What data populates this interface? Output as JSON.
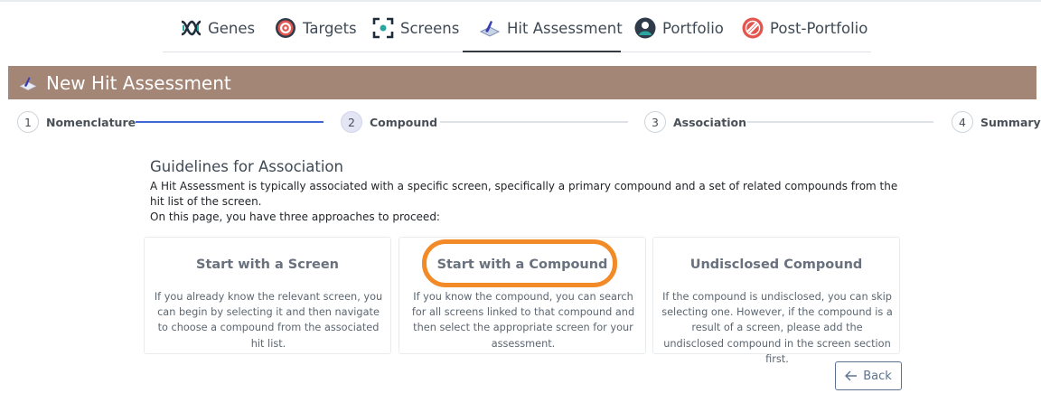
{
  "nav": {
    "items": [
      {
        "label": "Genes",
        "icon": "dna-icon"
      },
      {
        "label": "Targets",
        "icon": "target-icon"
      },
      {
        "label": "Screens",
        "icon": "screen-icon"
      },
      {
        "label": "Hit Assessment",
        "icon": "hit-assessment-icon"
      },
      {
        "label": "Portfolio",
        "icon": "portfolio-icon"
      },
      {
        "label": "Post-Portfolio",
        "icon": "post-portfolio-icon"
      }
    ],
    "active": "Hit Assessment"
  },
  "header": {
    "title": "New Hit Assessment",
    "color": "#a48677"
  },
  "steps": [
    {
      "number": "1",
      "label": "Nomenclature"
    },
    {
      "number": "2",
      "label": "Compound"
    },
    {
      "number": "3",
      "label": "Association"
    },
    {
      "number": "4",
      "label": "Summary"
    }
  ],
  "guidelines": {
    "title": "Guidelines for Association",
    "text": "A Hit Assessment is typically associated with a specific screen, specifically a primary compound and a set of related compounds from the hit list of the screen.",
    "text2": "On this page, you have three approaches to proceed:"
  },
  "cards": [
    {
      "title": "Start with a Screen",
      "description": "If you already know the relevant screen, you can begin by selecting it and then navigate to choose a compound from the associated hit list."
    },
    {
      "title": "Start with a Compound",
      "description": "If you know the compound, you can search for all screens linked to that compound and then select the appropriate screen for your assessment."
    },
    {
      "title": "Undisclosed Compound",
      "description": "If the compound is undisclosed, you can skip selecting one. However, if the compound is a result of a screen, please add the undisclosed compound in the screen section first."
    }
  ],
  "back_button": {
    "label": "Back"
  },
  "colors": {
    "highlight": "#f28a27",
    "step_progress": "#3f68d6"
  }
}
